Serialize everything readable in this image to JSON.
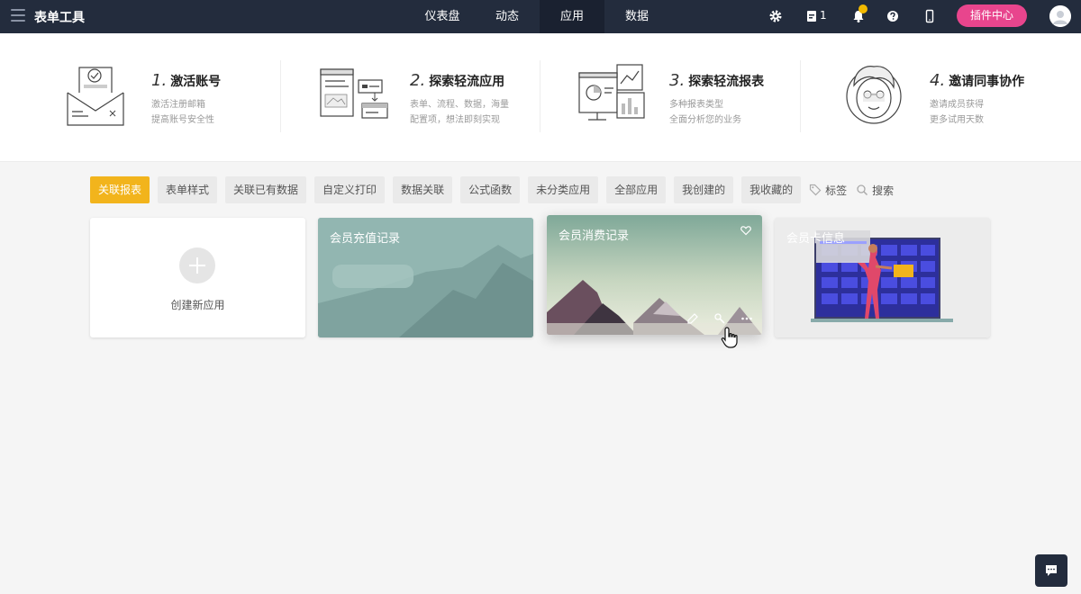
{
  "topbar": {
    "app_title": "表单工具",
    "nav": [
      {
        "label": "仪表盘",
        "active": false
      },
      {
        "label": "动态",
        "active": false
      },
      {
        "label": "应用",
        "active": true
      },
      {
        "label": "数据",
        "active": false
      }
    ],
    "doc_count": "1",
    "plugin_label": "插件中心",
    "icons": [
      "menu-icon",
      "gear-icon",
      "document-icon",
      "bell-icon",
      "help-icon",
      "mobile-icon",
      "avatar"
    ],
    "colors": {
      "bar": "#232c3d",
      "plugin": "#e8458d",
      "badge": "#f2b900"
    }
  },
  "guide": {
    "steps": [
      {
        "num": "1.",
        "title": "激活账号",
        "desc": [
          "激活注册邮箱",
          "提高账号安全性"
        ]
      },
      {
        "num": "2.",
        "title": "探索轻流应用",
        "desc": [
          "表单、流程、数据，海量",
          "配置项，想法即刻实现"
        ]
      },
      {
        "num": "3.",
        "title": "探索轻流报表",
        "desc": [
          "多种报表类型",
          "全面分析您的业务"
        ]
      },
      {
        "num": "4.",
        "title": "邀请同事协作",
        "desc": [
          "邀请成员获得",
          "更多试用天数"
        ]
      }
    ]
  },
  "filters": {
    "chips": [
      {
        "label": "关联报表",
        "active": true
      },
      {
        "label": "表单样式",
        "active": false
      },
      {
        "label": "关联已有数据",
        "active": false
      },
      {
        "label": "自定义打印",
        "active": false
      },
      {
        "label": "数据关联",
        "active": false
      },
      {
        "label": "公式函数",
        "active": false
      },
      {
        "label": "未分类应用",
        "active": false
      },
      {
        "label": "全部应用",
        "active": false
      },
      {
        "label": "我创建的",
        "active": false
      },
      {
        "label": "我收藏的",
        "active": false
      }
    ],
    "tag_label": "标签",
    "search_label": "搜索",
    "accent": "#f2b41c"
  },
  "cards": {
    "create_label": "创建新应用",
    "apps": [
      {
        "title": "会员充值记录"
      },
      {
        "title": "会员消费记录"
      },
      {
        "title": "会员卡信息"
      }
    ]
  }
}
